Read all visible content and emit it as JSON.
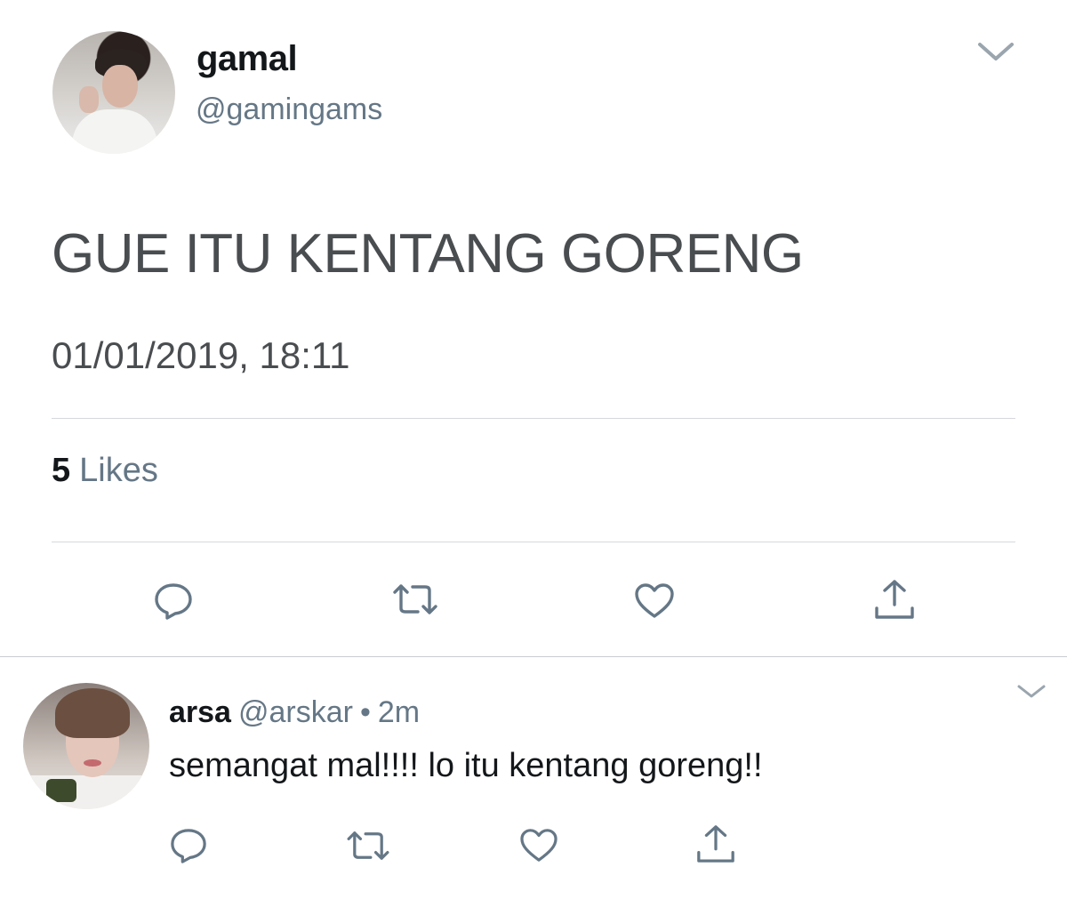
{
  "tweet": {
    "author_name": "gamal",
    "author_handle": "@gamingams",
    "text": "GUE ITU KENTANG GORENG",
    "timestamp": "01/01/2019, 18:11",
    "likes_count": "5",
    "likes_label": "Likes"
  },
  "reply": {
    "author_name": "arsa",
    "author_handle": "@arskar",
    "separator": "•",
    "time": "2m",
    "text": "semangat mal!!!! lo itu kentang goreng!!"
  },
  "icons": {
    "reply": "reply-icon",
    "retweet": "retweet-icon",
    "like": "heart-icon",
    "share": "share-icon",
    "menu": "chevron-down-icon"
  },
  "colors": {
    "primary_text": "#14171a",
    "secondary_text": "#657786",
    "icon": "#657786",
    "divider": "#d5d8db"
  }
}
